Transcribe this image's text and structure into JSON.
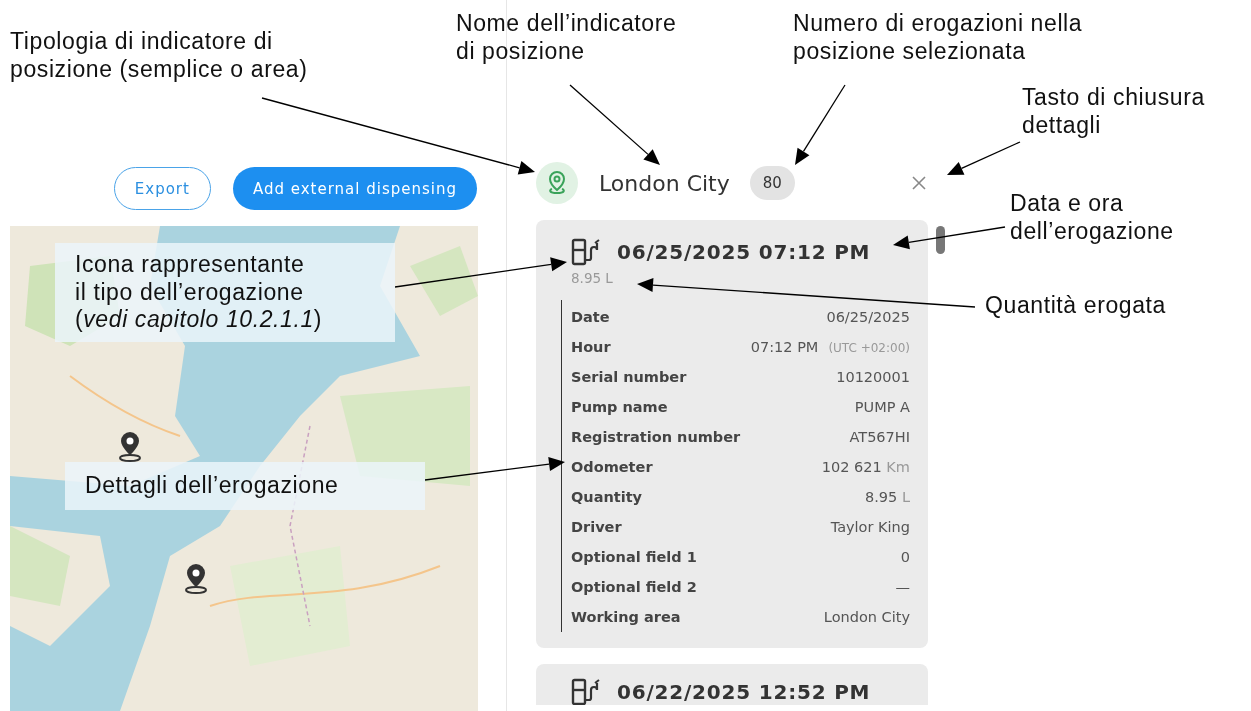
{
  "toolbar": {
    "buttons": [
      {
        "label": "Export",
        "kind": "outline"
      },
      {
        "label": "Add external dispensing",
        "kind": "primary"
      }
    ]
  },
  "location": {
    "kind": "simple",
    "name": "London City",
    "count": "80"
  },
  "dispensings": [
    {
      "kind": "fuel",
      "datetime": "06/25/2025 07:12 PM",
      "quantity": "8.95",
      "unit": "L",
      "expanded": true,
      "details": [
        {
          "label": "Date",
          "value": "06/25/2025"
        },
        {
          "label": "Hour",
          "value": "07:12 PM",
          "note": "(UTC +02:00)"
        },
        {
          "label": "Serial number",
          "value": "10120001"
        },
        {
          "label": "Pump name",
          "value": "PUMP A"
        },
        {
          "label": "Registration number",
          "value": "AT567HI"
        },
        {
          "label": "Odometer",
          "value": "102 621",
          "unit": "Km"
        },
        {
          "label": "Quantity",
          "value": "8.95",
          "unit": "L"
        },
        {
          "label": "Driver",
          "value": "Taylor King"
        },
        {
          "label": "Optional field 1",
          "value": "0"
        },
        {
          "label": "Optional field 2",
          "value": "—"
        },
        {
          "label": "Working area",
          "value": "London City"
        }
      ]
    },
    {
      "kind": "fuel",
      "datetime": "06/22/2025 12:52 PM",
      "expanded": false
    }
  ],
  "annotations": [
    {
      "text": "Tipologia di indicatore di\nposizione (semplice o area)",
      "boxed": false
    },
    {
      "text": "Nome dell’indicatore\ndi posizione",
      "boxed": false
    },
    {
      "text": "Numero di erogazioni nella\nposizione selezionata",
      "boxed": false
    },
    {
      "text": "Tasto di chiusura\ndettagli",
      "boxed": false
    },
    {
      "text": "Data e ora\ndell’erogazione",
      "boxed": false
    },
    {
      "text": "Quantità erogata",
      "boxed": false
    },
    {
      "text": "Icona rappresentante\nil tipo dell’erogazione\n(*vedi capitolo 10.2.1.1*)",
      "boxed": true
    },
    {
      "text": "Dettagli dell’erogazione",
      "boxed": true
    }
  ]
}
